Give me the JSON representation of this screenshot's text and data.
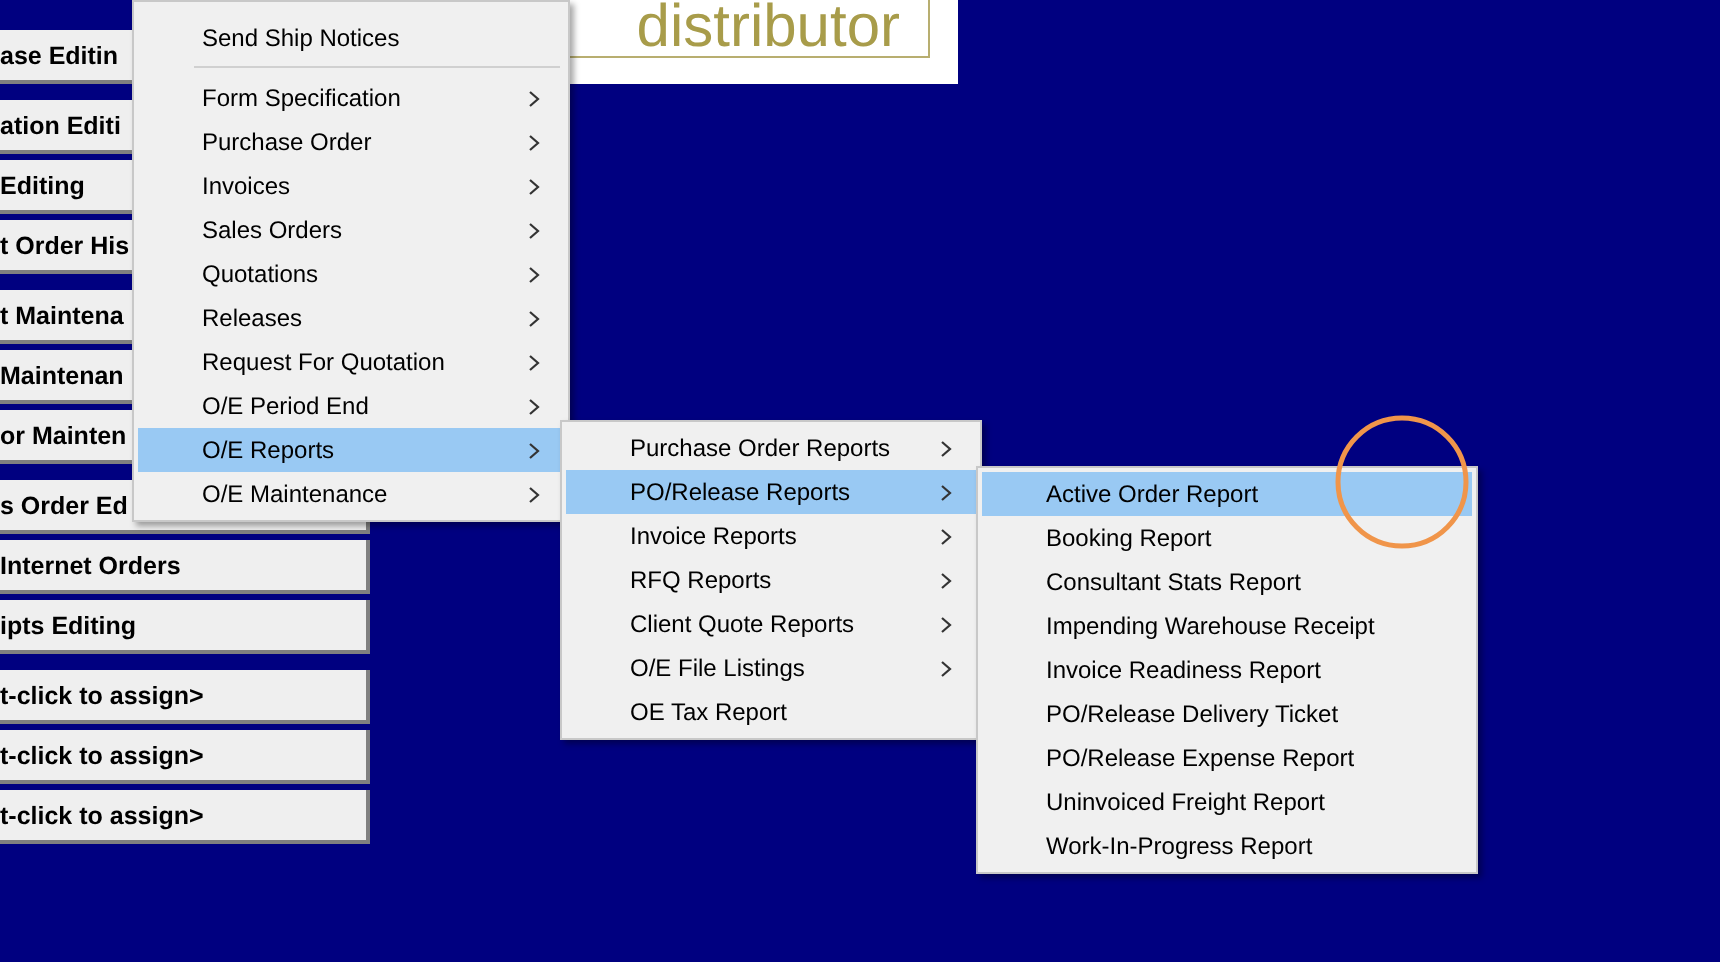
{
  "logo": {
    "text": "distributor"
  },
  "button_groups": [
    [
      {
        "label": "ase Editin"
      }
    ],
    [
      {
        "label": "ation Editi"
      },
      {
        "label": "Editing"
      },
      {
        "label": "t Order His"
      }
    ],
    [
      {
        "label": "t Maintena"
      },
      {
        "label": "Maintenan"
      },
      {
        "label": "or Mainten"
      }
    ],
    [
      {
        "label": "s Order Ed"
      },
      {
        "label": "Internet Orders"
      },
      {
        "label": "ipts Editing"
      }
    ],
    [
      {
        "label": "t-click to assign>"
      },
      {
        "label": "t-click to assign>"
      },
      {
        "label": "t-click to assign>"
      }
    ]
  ],
  "menus": [
    {
      "items": [
        {
          "kind": "item",
          "label": "Send Ship Notices",
          "submenu": false,
          "selected": false
        },
        {
          "kind": "separator"
        },
        {
          "kind": "item",
          "label": "Form Specification",
          "submenu": true,
          "selected": false
        },
        {
          "kind": "item",
          "label": "Purchase Order",
          "submenu": true,
          "selected": false
        },
        {
          "kind": "item",
          "label": "Invoices",
          "submenu": true,
          "selected": false
        },
        {
          "kind": "item",
          "label": "Sales Orders",
          "submenu": true,
          "selected": false
        },
        {
          "kind": "item",
          "label": "Quotations",
          "submenu": true,
          "selected": false
        },
        {
          "kind": "item",
          "label": "Releases",
          "submenu": true,
          "selected": false
        },
        {
          "kind": "item",
          "label": "Request For Quotation",
          "submenu": true,
          "selected": false
        },
        {
          "kind": "item",
          "label": "O/E Period End",
          "submenu": true,
          "selected": false
        },
        {
          "kind": "item",
          "label": "O/E Reports",
          "submenu": true,
          "selected": true
        },
        {
          "kind": "item",
          "label": "O/E Maintenance",
          "submenu": true,
          "selected": false
        }
      ]
    },
    {
      "items": [
        {
          "kind": "item",
          "label": "Purchase Order Reports",
          "submenu": true,
          "selected": false
        },
        {
          "kind": "item",
          "label": "PO/Release Reports",
          "submenu": true,
          "selected": true
        },
        {
          "kind": "item",
          "label": "Invoice Reports",
          "submenu": true,
          "selected": false
        },
        {
          "kind": "item",
          "label": "RFQ Reports",
          "submenu": true,
          "selected": false
        },
        {
          "kind": "item",
          "label": "Client Quote Reports",
          "submenu": true,
          "selected": false
        },
        {
          "kind": "item",
          "label": "O/E File Listings",
          "submenu": true,
          "selected": false
        },
        {
          "kind": "item",
          "label": "OE Tax Report",
          "submenu": false,
          "selected": false
        }
      ]
    },
    {
      "items": [
        {
          "kind": "item",
          "label": "Active Order Report",
          "submenu": false,
          "selected": true
        },
        {
          "kind": "item",
          "label": "Booking Report",
          "submenu": false,
          "selected": false
        },
        {
          "kind": "item",
          "label": "Consultant Stats Report",
          "submenu": false,
          "selected": false
        },
        {
          "kind": "item",
          "label": "Impending Warehouse Receipt",
          "submenu": false,
          "selected": false
        },
        {
          "kind": "item",
          "label": "Invoice Readiness Report",
          "submenu": false,
          "selected": false
        },
        {
          "kind": "item",
          "label": "PO/Release Delivery Ticket",
          "submenu": false,
          "selected": false
        },
        {
          "kind": "item",
          "label": "PO/Release Expense Report",
          "submenu": false,
          "selected": false
        },
        {
          "kind": "item",
          "label": "Uninvoiced Freight Report",
          "submenu": false,
          "selected": false
        },
        {
          "kind": "item",
          "label": "Work-In-Progress Report",
          "submenu": false,
          "selected": false
        }
      ]
    }
  ]
}
